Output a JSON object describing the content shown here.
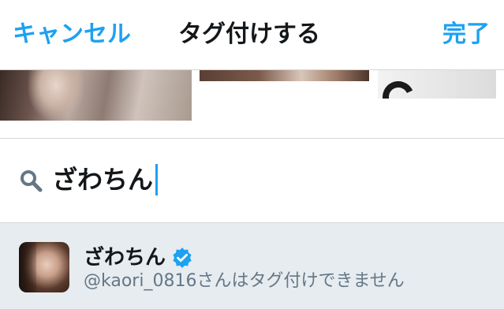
{
  "nav": {
    "cancel_label": "キャンセル",
    "title": "タグ付けする",
    "done_label": "完了"
  },
  "search": {
    "query": "ざわちん"
  },
  "results": [
    {
      "name": "ざわちん",
      "verified": true,
      "handle_note": "@kaori_0816さんはタグ付けできません"
    }
  ],
  "colors": {
    "accent": "#1da1f2",
    "text_primary": "#14171a",
    "text_secondary": "#657786",
    "result_highlight": "#e6ecf0",
    "divider": "#d6d6d6"
  },
  "icons": {
    "search": "search-icon",
    "verified": "verified-badge-icon"
  }
}
